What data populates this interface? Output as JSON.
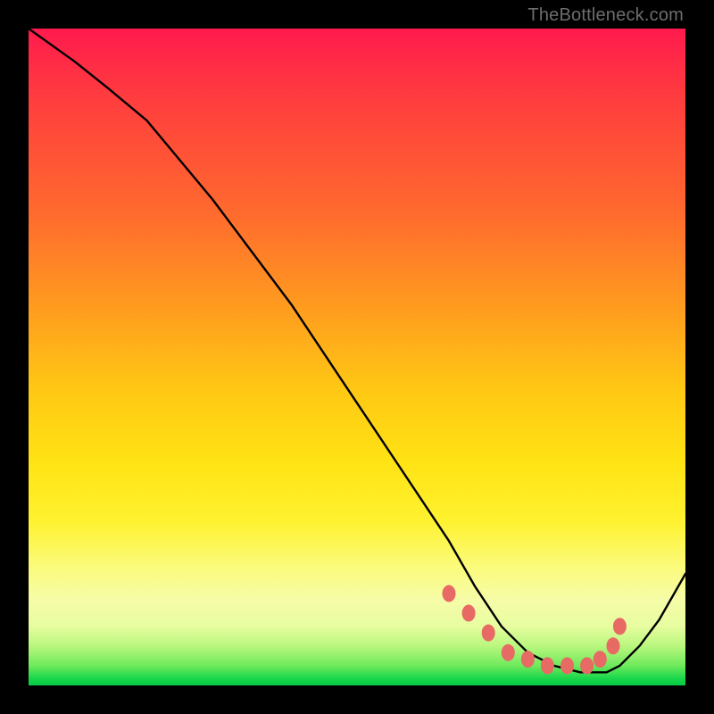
{
  "watermark": "TheBottleneck.com",
  "chart_data": {
    "type": "line",
    "title": "",
    "xlabel": "",
    "ylabel": "",
    "xlim": [
      0,
      100
    ],
    "ylim": [
      0,
      100
    ],
    "grid": false,
    "series": [
      {
        "name": "curve",
        "x": [
          0,
          7,
          12,
          18,
          28,
          40,
          52,
          60,
          64,
          68,
          72,
          76,
          80,
          84,
          88,
          90,
          93,
          96,
          100
        ],
        "y": [
          100,
          95,
          91,
          86,
          74,
          58,
          40,
          28,
          22,
          15,
          9,
          5,
          3,
          2,
          2,
          3,
          6,
          10,
          17
        ]
      }
    ],
    "markers": {
      "name": "highlight-dots",
      "x": [
        64,
        67,
        70,
        73,
        76,
        79,
        82,
        85,
        87,
        89,
        90
      ],
      "y": [
        14,
        11,
        8,
        5,
        4,
        3,
        3,
        3,
        4,
        6,
        9
      ]
    }
  }
}
